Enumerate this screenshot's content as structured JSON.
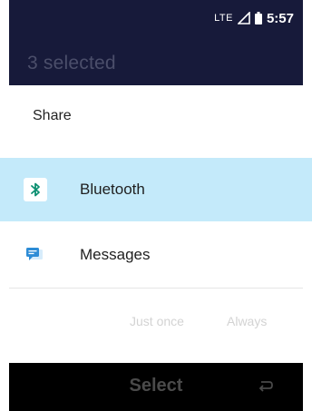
{
  "status_bar": {
    "network": "LTE",
    "signal_icon": "signal-icon",
    "battery_icon": "battery-icon",
    "time": "5:57"
  },
  "app_bar": {
    "title": "3 selected"
  },
  "share_dialog": {
    "title": "Share",
    "options": [
      {
        "label": "Bluetooth",
        "icon": "bluetooth-icon",
        "selected": true
      },
      {
        "label": "Messages",
        "icon": "messages-icon",
        "selected": false
      }
    ],
    "actions": {
      "just_once": "Just once",
      "always": "Always"
    }
  },
  "softkeys": {
    "center": "Select",
    "right_icon": "back-icon"
  },
  "colors": {
    "header_bg": "#171a3a",
    "selected_row": "#c4eafa",
    "bluetooth_icon": "#0b8f70",
    "messages_icon": "#2d8cd6"
  }
}
